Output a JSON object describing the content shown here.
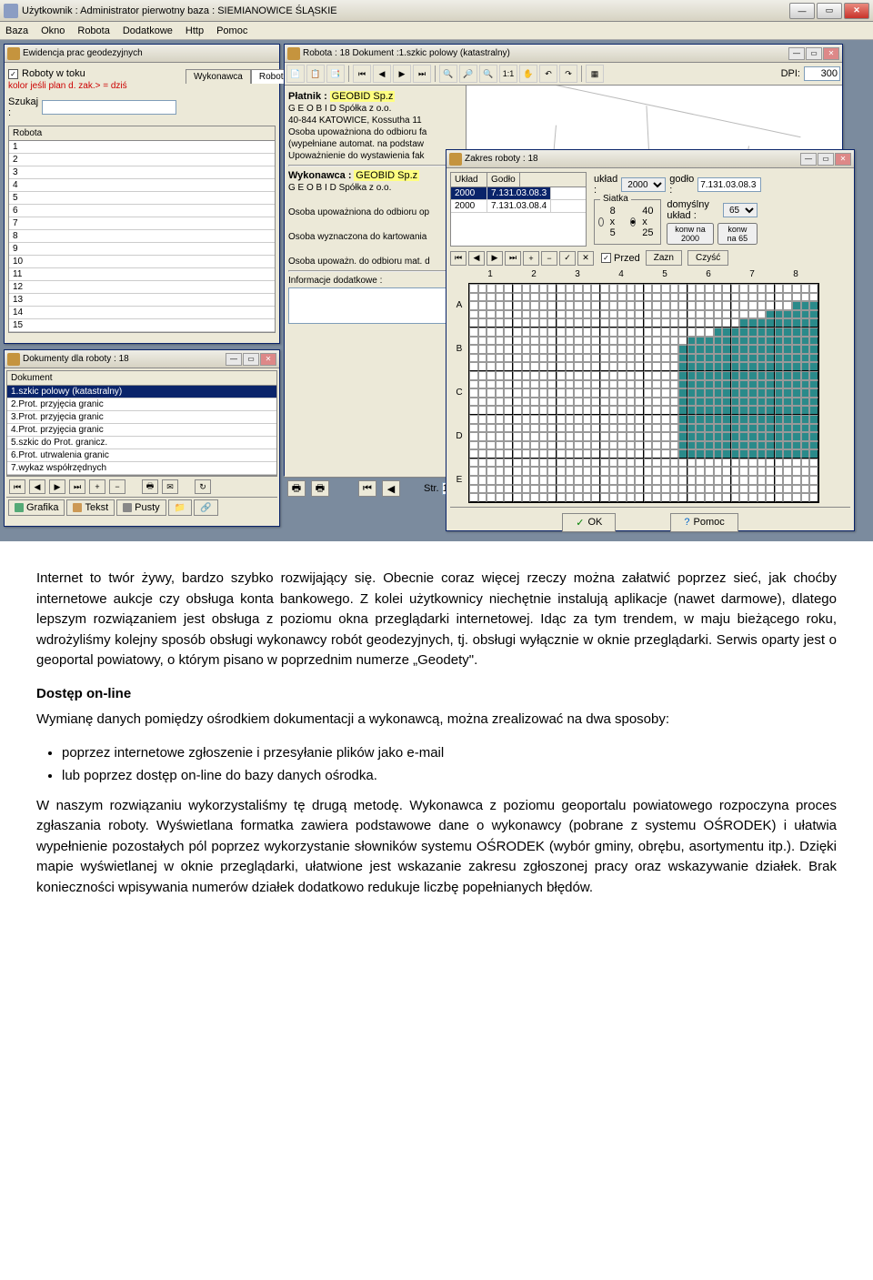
{
  "main_window": {
    "title": "Użytkownik : Administrator pierwotny   baza : SIEMIANOWICE ŚLĄSKIE",
    "menu": [
      "Baza",
      "Okno",
      "Robota",
      "Dodatkowe",
      "Http",
      "Pomoc"
    ]
  },
  "win_evid": {
    "title": "Ewidencja prac geodezyjnych",
    "chk_label": "Roboty w toku",
    "red_text": "kolor jeśli plan d. zak.> = dziś",
    "szukaj_label": "Szukaj :",
    "tabs": [
      "Wykonawca",
      "Robota"
    ],
    "table_header": "Robota",
    "rows": [
      "1",
      "2",
      "3",
      "4",
      "5",
      "6",
      "7",
      "8",
      "9",
      "10",
      "11",
      "12",
      "13",
      "14",
      "15"
    ]
  },
  "win_dok": {
    "title": "Dokumenty dla roboty : 18",
    "header": "Dokument",
    "rows": [
      "1.szkic polowy (katastralny)",
      "2.Prot. przyjęcia granic",
      "3.Prot. przyjęcia granic",
      "4.Prot. przyjęcia granic",
      "5.szkic do Prot. granicz.",
      "6.Prot. utrwalenia granic",
      "7.wykaz współrzędnych"
    ],
    "bottom_tabs": [
      "Grafika",
      "Tekst",
      "Pusty"
    ]
  },
  "win_robota": {
    "title": "Robota : 18   Dokument :1.szkic polowy (katastralny)",
    "dpi_label": "DPI:",
    "dpi_value": "300",
    "platnik_label": "Płatnik :",
    "platnik_hl": "GEOBID   Sp.z",
    "line1": "G E O B I D  Spółka z o.o.",
    "line2": "40-844 KATOWICE, Kossutha 11",
    "line3": "Osoba upoważniona do odbioru fa",
    "line4": "(wypełniane automat. na podstaw",
    "line5": "Upoważnienie do wystawienia  fak",
    "wyk_label": "Wykonawca :",
    "wyk_hl": "GEOBID   Sp.z",
    "line6": "G E O B I D  Spółka z o.o.",
    "line7": "Osoba upoważniona do odbioru op",
    "line8": "Osoba wyznaczona do kartowania",
    "line9": "Osoba upoważn. do odbioru mat. d",
    "line10": "Informacje dodatkowe :",
    "str_label": "Str."
  },
  "win_zakres": {
    "title": "Zakres roboty : 18",
    "tbl_hdr": [
      "Układ",
      "Godło"
    ],
    "tbl_rows": [
      [
        "2000",
        "7.131.03.08.3"
      ],
      [
        "2000",
        "7.131.03.08.4"
      ]
    ],
    "uklad_label": "układ :",
    "uklad_val": "2000",
    "godlo_label": "godło :",
    "godlo_val": "7.131.03.08.3",
    "siatka": "Siatka",
    "r1": "8 x 5",
    "r2": "40 x 25",
    "dom_label": "domyślny układ :",
    "dom_val": "65",
    "konw1": "konw na 2000",
    "konw2": "konw na 65",
    "przed": "Przed",
    "zazn": "Zazn",
    "czysc": "Czyść",
    "cols": [
      "1",
      "2",
      "3",
      "4",
      "5",
      "6",
      "7",
      "8"
    ],
    "rows_lbl": [
      "A",
      "B",
      "C",
      "D",
      "E"
    ],
    "ok": "OK",
    "pomoc": "Pomoc"
  },
  "article": {
    "p1": "Internet to twór żywy, bardzo szybko rozwijający się. Obecnie coraz więcej rzeczy można załatwić poprzez sieć, jak choćby internetowe aukcje czy obsługa konta bankowego. Z kolei użytkownicy niechętnie instalują aplikacje (nawet darmowe), dlatego lepszym rozwiązaniem jest obsługa z poziomu okna przeglądarki internetowej. Idąc za tym trendem, w maju bieżącego roku, wdrożyliśmy kolejny sposób obsługi wykonawcy robót geodezyjnych, tj. obsługi wyłącznie w oknie przeglądarki. Serwis oparty jest o geoportal powiatowy, o którym pisano w poprzednim numerze „Geodety\".",
    "h1": "Dostęp on-line",
    "p2": "Wymianę danych pomiędzy ośrodkiem dokumentacji a wykonawcą, można zrealizować na dwa sposoby:",
    "li1": "poprzez internetowe zgłoszenie i przesyłanie plików jako e-mail",
    "li2": "lub poprzez dostęp on-line do bazy danych ośrodka.",
    "p3": "W naszym rozwiązaniu wykorzystaliśmy tę drugą metodę. Wykonawca z poziomu geoportalu powiatowego rozpoczyna proces zgłaszania roboty. Wyświetlana formatka zawiera podstawowe dane o wykonawcy (pobrane z systemu OŚRODEK) i ułatwia wypełnienie pozostałych pól poprzez wykorzystanie słowników systemu OŚRODEK (wybór gminy, obrębu, asortymentu itp.). Dzięki mapie wyświetlanej w oknie przeglądarki, ułatwione jest wskazanie zakresu zgłoszonej pracy oraz wskazywanie działek. Brak konieczności wpisywania numerów działek dodatkowo redukuje liczbę popełnianych błędów."
  }
}
